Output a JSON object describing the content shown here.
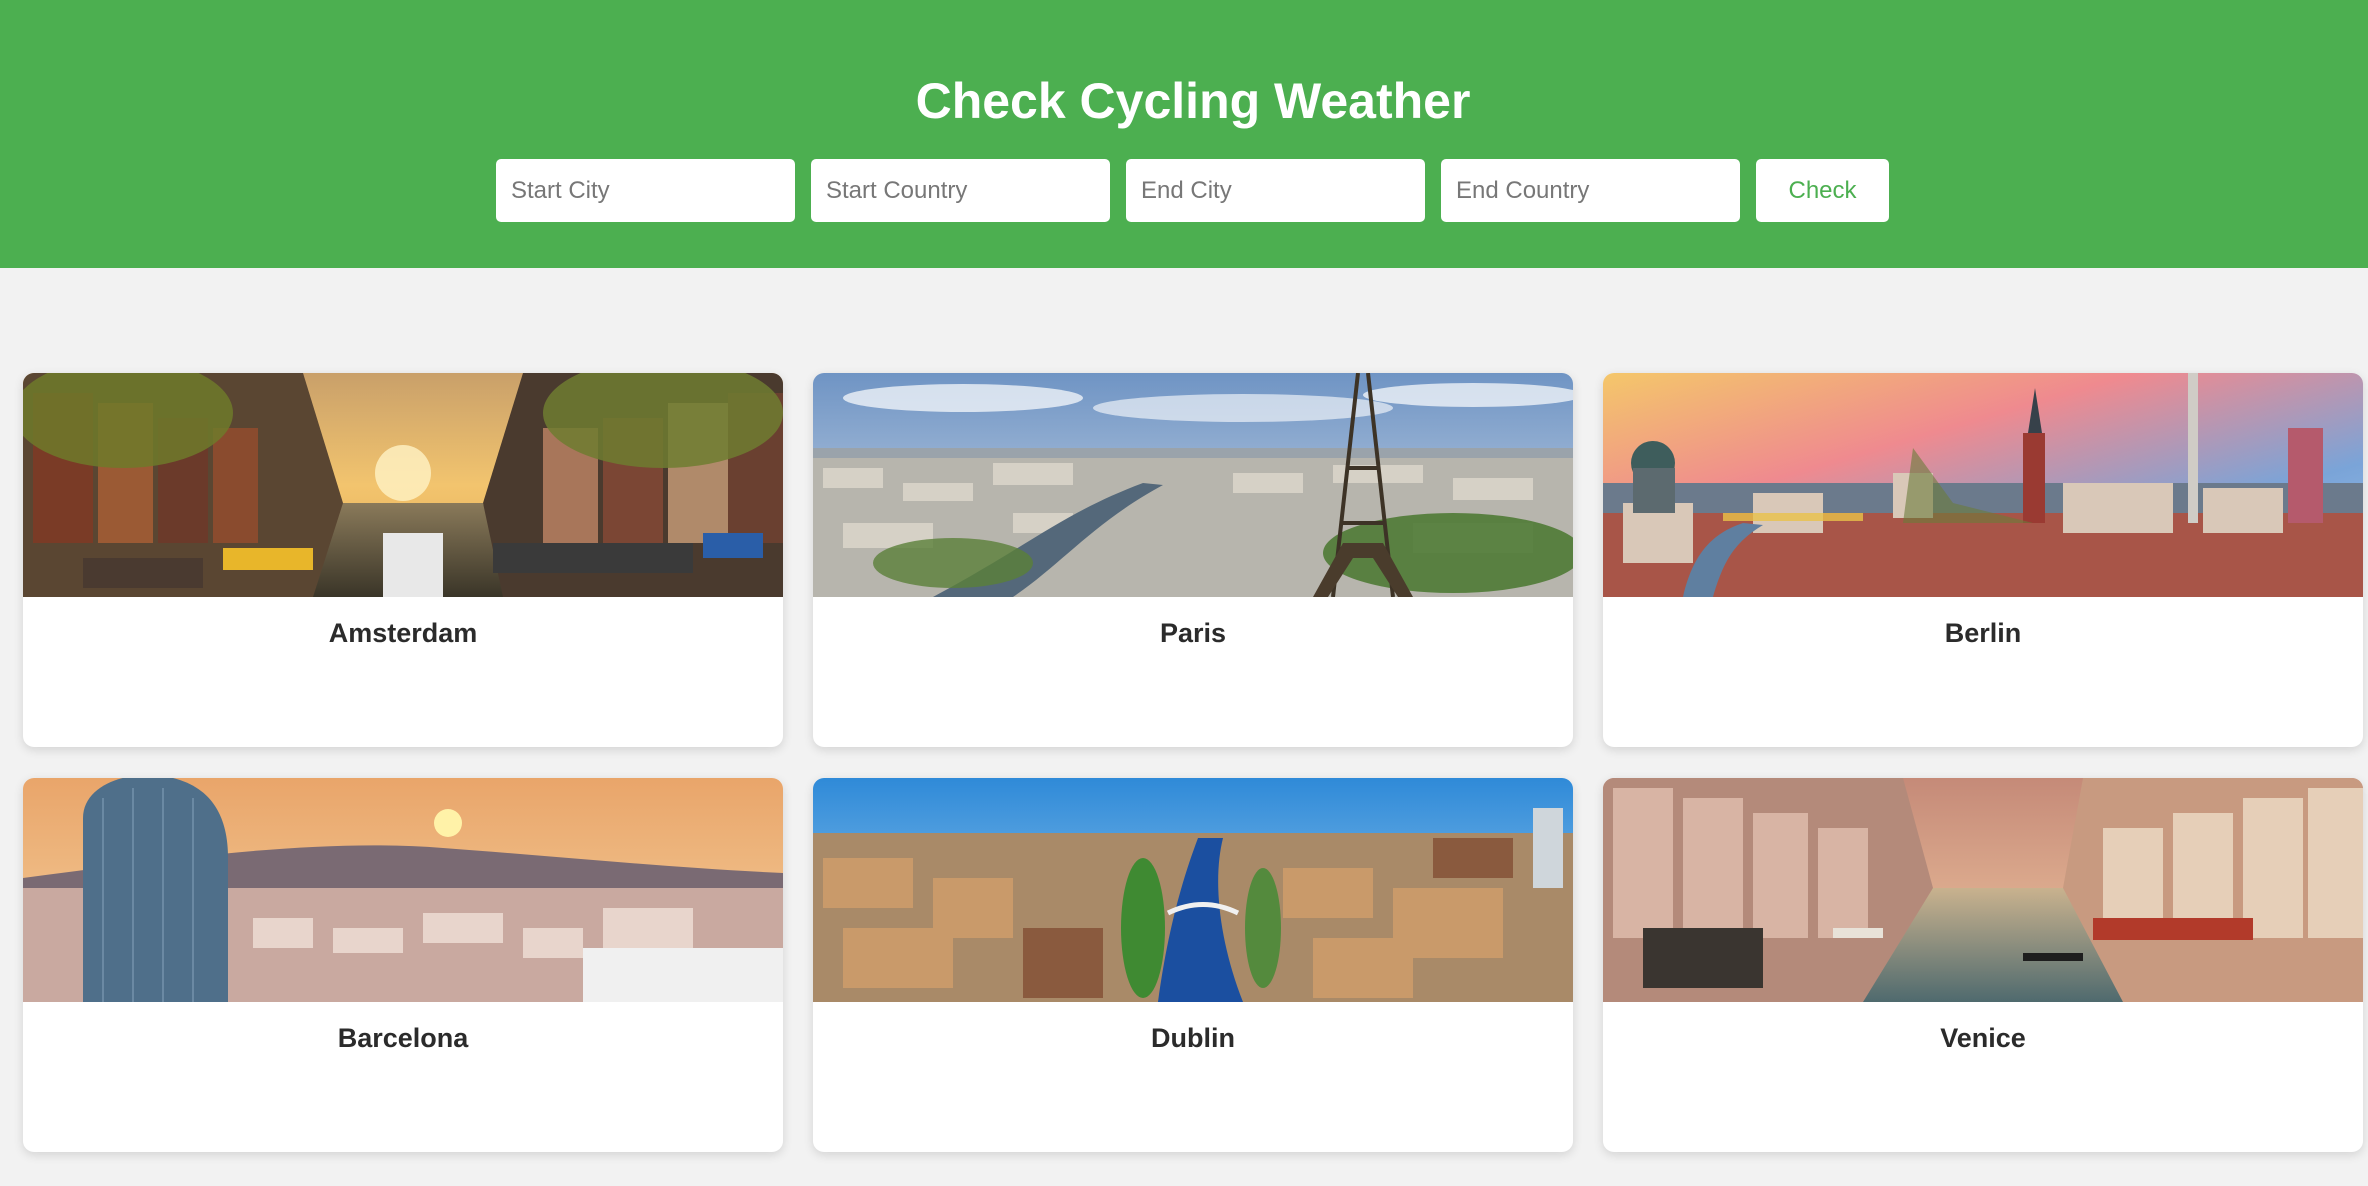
{
  "header": {
    "title": "Check Cycling Weather",
    "background_color": "#4caf50"
  },
  "form": {
    "start_city_placeholder": "Start City",
    "start_country_placeholder": "Start Country",
    "end_city_placeholder": "End City",
    "end_country_placeholder": "End Country",
    "check_label": "Check"
  },
  "cities": [
    {
      "name": "Amsterdam"
    },
    {
      "name": "Paris"
    },
    {
      "name": "Berlin"
    },
    {
      "name": "Barcelona"
    },
    {
      "name": "Dublin"
    },
    {
      "name": "Venice"
    }
  ]
}
